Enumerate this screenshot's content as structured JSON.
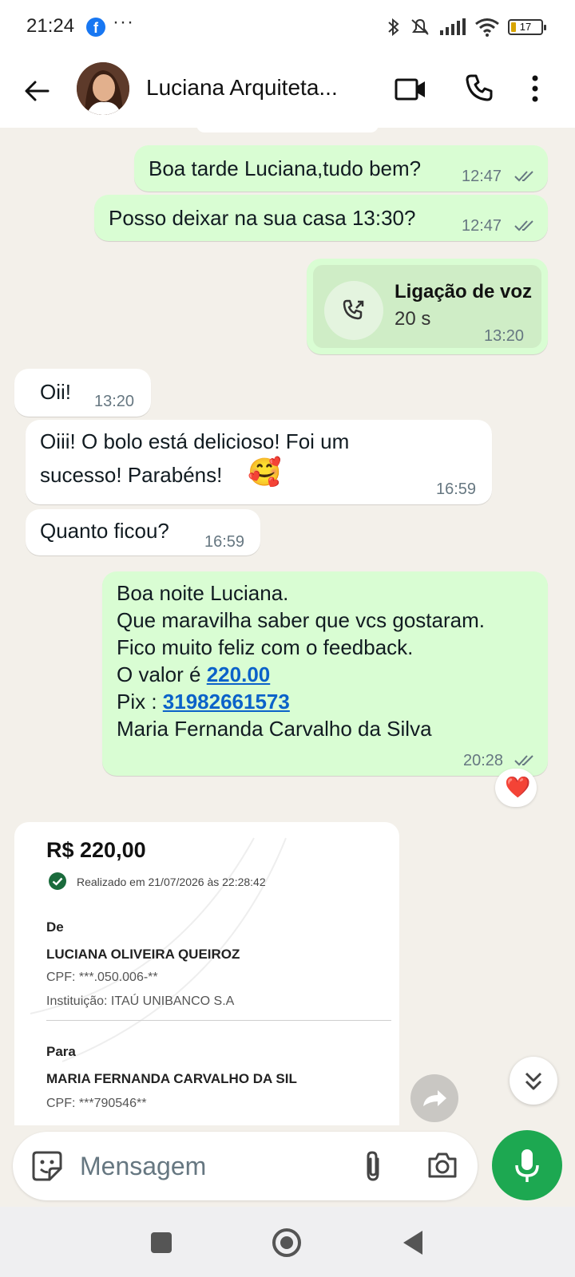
{
  "status_bar": {
    "time": "21:24",
    "battery_percent": 17,
    "battery_label": "17",
    "icons": [
      "facebook-icon",
      "more-dots",
      "bluetooth-icon",
      "silent-icon",
      "signal-icon",
      "wifi-icon",
      "battery-icon"
    ]
  },
  "header": {
    "contact_name": "Luciana Arquiteta...",
    "icons": [
      "back-arrow-icon",
      "video-call-icon",
      "phone-icon",
      "more-vert-icon"
    ]
  },
  "messages": [
    {
      "dir": "out",
      "text": "Boa tarde Luciana,tudo bem?",
      "time": "12:47",
      "status": "read"
    },
    {
      "dir": "out",
      "text": "Posso deixar na sua casa 13:30?",
      "time": "12:47",
      "status": "read"
    },
    {
      "dir": "out",
      "type": "voice_call",
      "title": "Ligação de voz",
      "duration": "20 s",
      "time": "13:20"
    },
    {
      "dir": "in",
      "text": "Oii!",
      "time": "13:20"
    },
    {
      "dir": "in",
      "lines": [
        "Oiii! O bolo está delicioso! Foi um",
        "sucesso! Parabéns!"
      ],
      "emoji": "🥰",
      "time": "16:59"
    },
    {
      "dir": "in",
      "text": "Quanto ficou?",
      "time": "16:59"
    },
    {
      "dir": "out",
      "lines": [
        "Boa noite Luciana.",
        "Que maravilha saber que vcs gostaram.",
        "Fico muito feliz com o feedback."
      ],
      "value_prefix": "O valor é ",
      "value_link": "220.00",
      "pix_prefix": "Pix : ",
      "pix_link": "31982661573",
      "last_line": "Maria Fernanda Carvalho da Silva",
      "time": "20:28",
      "status": "read",
      "reaction": "❤️"
    }
  ],
  "receipt": {
    "amount": "R$ 220,00",
    "date": "Realizado em 21/07/2026 às 22:28:42",
    "from_label": "De",
    "from_name": "LUCIANA OLIVEIRA QUEIROZ",
    "from_cpf": "CPF:  ***.050.006-**",
    "from_inst": "Instituição:  ITAÚ UNIBANCO S.A",
    "to_label": "Para",
    "to_name": "MARIA FERNANDA CARVALHO DA SIL",
    "to_cpf": "CPF:  ***790546**"
  },
  "input": {
    "placeholder": "Mensagem"
  },
  "colors": {
    "chat_bg": "#f3f0ea",
    "outgoing_bubble": "#d9fdd3",
    "incoming_bubble": "#ffffff",
    "link": "#0b62c9",
    "mic_button": "#1da851",
    "read_ticks": "#667781"
  }
}
